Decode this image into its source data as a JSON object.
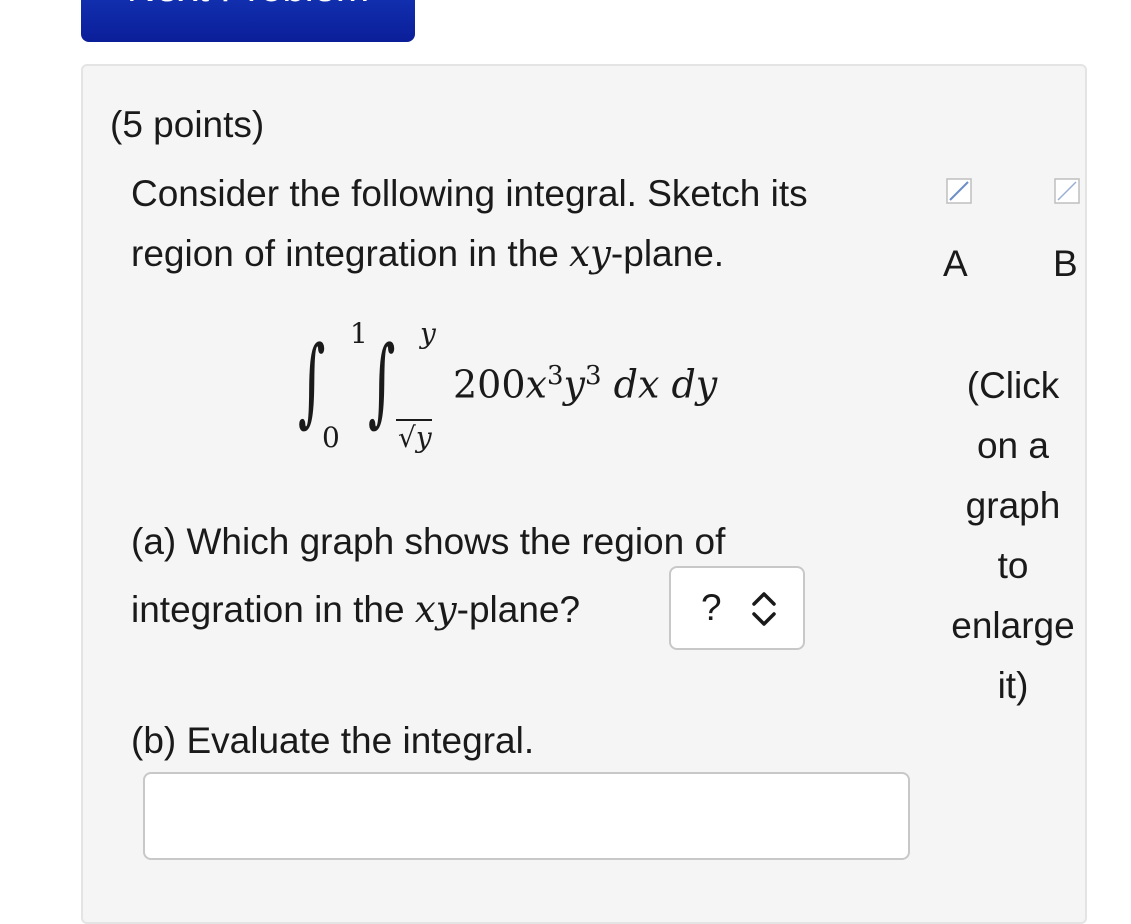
{
  "nav": {
    "next_problem_label": "Next Problem"
  },
  "problem": {
    "points": "(5 points)",
    "prompt_line1": "Consider the following integral. Sketch its",
    "prompt_line2_pre": "region of integration in the ",
    "prompt_line2_math": "xy",
    "prompt_line2_post": "-plane.",
    "integral": {
      "outer_upper": "1",
      "outer_lower": "0",
      "inner_upper": "y",
      "inner_lower": "√y",
      "integrand_coeff": "200",
      "integrand_x": "x",
      "integrand_y": "y",
      "exp_x": "3",
      "exp_y": "3",
      "differentials": "dx dy"
    },
    "part_a": {
      "line1": "(a) Which graph shows the region of",
      "line2_pre": "integration in the ",
      "line2_math": "xy",
      "line2_post": "-plane?",
      "select_value": "?"
    },
    "part_b": {
      "label": "(b) Evaluate the integral.",
      "input_value": ""
    }
  },
  "graphs": {
    "label_a": "A",
    "label_b": "B",
    "hint_lines": [
      "(Click",
      "on a",
      "graph",
      "to",
      "enlarge",
      "it)"
    ]
  },
  "colors": {
    "button_bg": "#0b1e99",
    "panel_bg": "#f5f5f5",
    "text": "#1a1a1a"
  }
}
